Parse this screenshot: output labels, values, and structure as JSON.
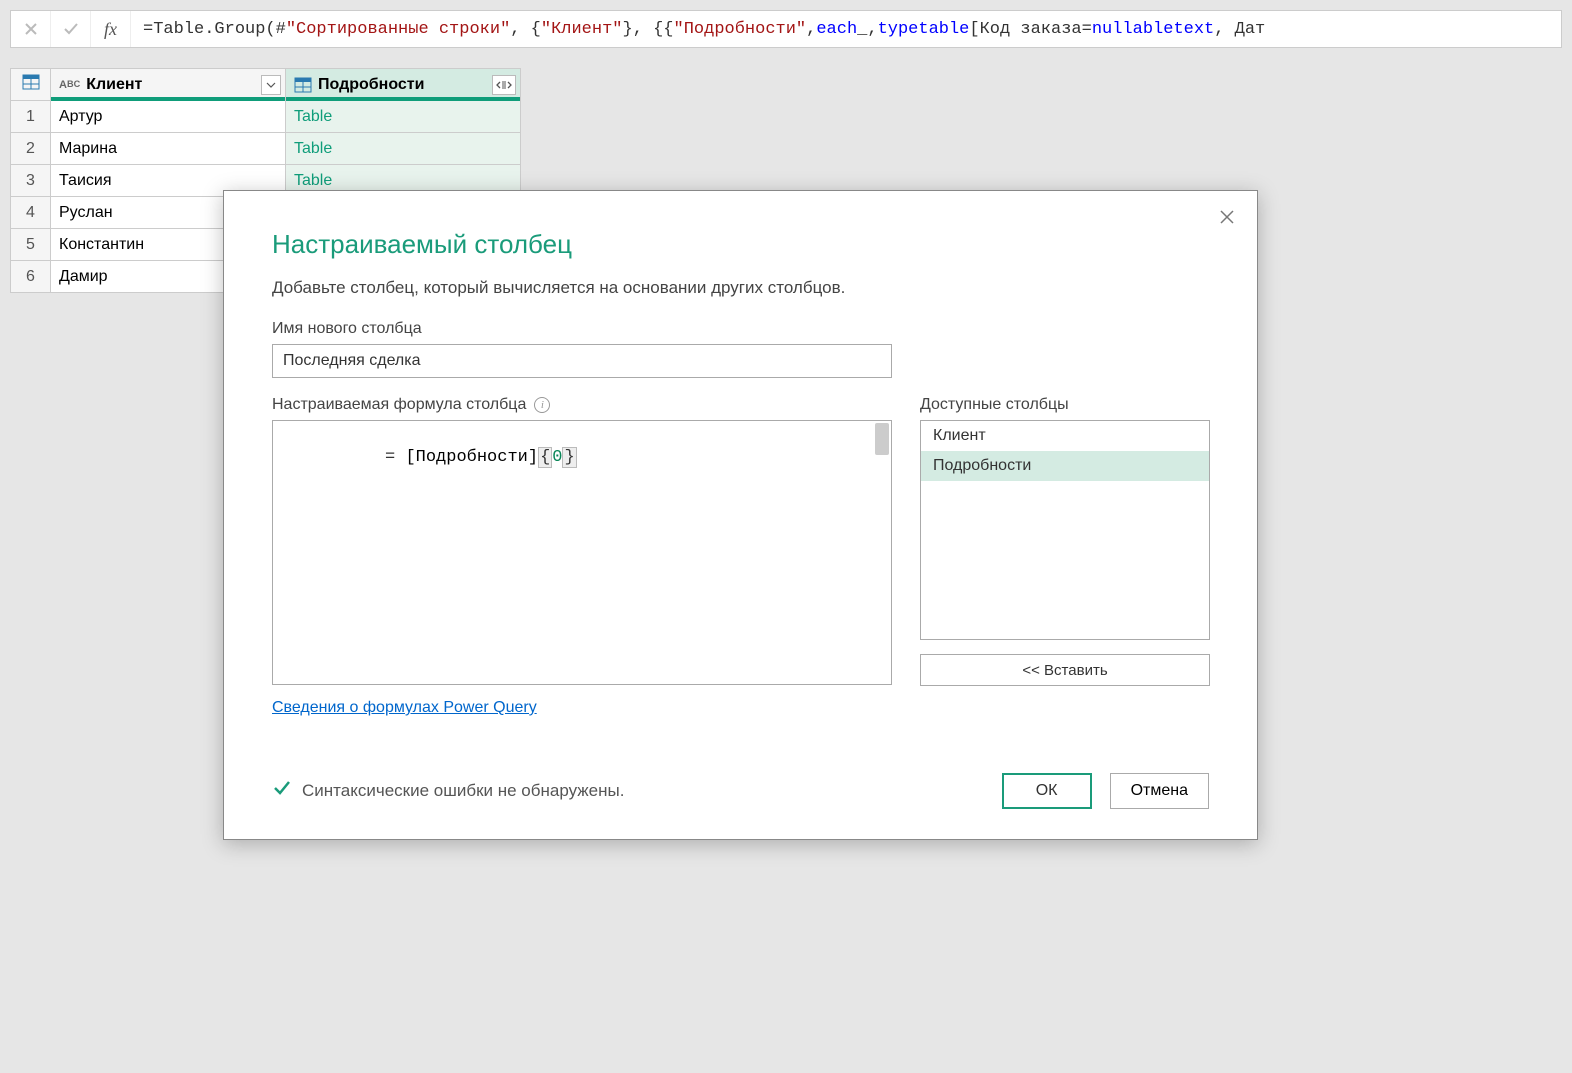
{
  "formula_bar": {
    "prefix": "= ",
    "fn": "Table.Group",
    "open": "(#",
    "arg1": "\"Сортированные строки\"",
    "sep1": ", {",
    "arg2": "\"Клиент\"",
    "sep2": "}, {{",
    "arg3": "\"Подробности\"",
    "sep3": ", ",
    "each": "each",
    "sep4": " _, ",
    "type": "type",
    "sp": " ",
    "table": "table",
    "sep5": " [Код заказа=",
    "nullable": "nullable",
    "sp2": " ",
    "text": "text",
    "tail": ", Дат"
  },
  "columns": {
    "client": "Клиент",
    "details": "Подробности"
  },
  "rows": [
    {
      "n": "1",
      "client": "Артур",
      "details": "Table"
    },
    {
      "n": "2",
      "client": "Марина",
      "details": "Table"
    },
    {
      "n": "3",
      "client": "Таисия",
      "details": "Table"
    },
    {
      "n": "4",
      "client": "Руслан",
      "details": ""
    },
    {
      "n": "5",
      "client": "Константин",
      "details": ""
    },
    {
      "n": "6",
      "client": "Дамир",
      "details": ""
    }
  ],
  "dialog": {
    "title": "Настраиваемый столбец",
    "subtitle": "Добавьте столбец, который вычисляется на основании других столбцов.",
    "name_label": "Имя нового столбца",
    "name_value": "Последняя сделка",
    "formula_label": "Настраиваемая формула столбца",
    "formula_tokens": {
      "eq": "= ",
      "bracket_open": "[",
      "field": "Подробности",
      "bracket_close": "]",
      "brace_open": "{",
      "num": "0",
      "brace_close": "}"
    },
    "available_label": "Доступные столбцы",
    "available": [
      "Клиент",
      "Подробности"
    ],
    "insert_label": "<< Вставить",
    "help_link": "Сведения о формулах Power Query",
    "status": "Синтаксические ошибки не обнаружены.",
    "ok": "ОК",
    "cancel": "Отмена"
  }
}
